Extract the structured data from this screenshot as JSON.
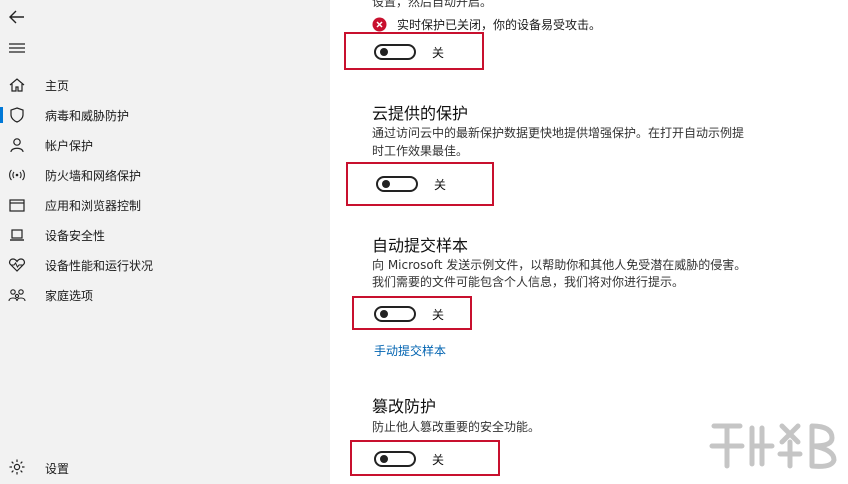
{
  "sidebar": {
    "items": [
      {
        "label": "主页",
        "icon": "home-icon"
      },
      {
        "label": "病毒和威胁防护",
        "icon": "shield-icon"
      },
      {
        "label": "帐户保护",
        "icon": "person-icon"
      },
      {
        "label": "防火墙和网络保护",
        "icon": "wifi-icon"
      },
      {
        "label": "应用和浏览器控制",
        "icon": "window-icon"
      },
      {
        "label": "设备安全性",
        "icon": "laptop-icon"
      },
      {
        "label": "设备性能和运行状况",
        "icon": "heart-icon"
      },
      {
        "label": "家庭选项",
        "icon": "family-icon"
      }
    ],
    "settings_label": "设置"
  },
  "main": {
    "top_cut_text": "设置，然后自动开启。",
    "warning_text": "实时保护已关闭，你的设备易受攻击。",
    "realtime_toggle_label": "关",
    "cloud": {
      "title": "云提供的保护",
      "desc1": "通过访问云中的最新保护数据更快地提供增强保护。在打开自动示例提",
      "desc2": "时工作效果最佳。",
      "toggle_label": "关"
    },
    "sample": {
      "title": "自动提交样本",
      "desc1": "向 Microsoft 发送示例文件，以帮助你和其他人免受潜在威胁的侵害。",
      "desc2": "我们需要的文件可能包含个人信息，我们将对你进行提示。",
      "toggle_label": "关",
      "link": "手动提交样本"
    },
    "tamper": {
      "title": "篡改防护",
      "desc": "防止他人篡改重要的安全功能。",
      "toggle_label": "关"
    }
  },
  "toggles_state": {
    "realtime": 0,
    "cloud": 0,
    "sample": 0,
    "tamper": 0
  },
  "colors": {
    "accent": "#0078d7",
    "link": "#0063b1",
    "error": "#c8102e",
    "highlight_box": "#c8102e",
    "sidebar_bg": "#f2f2f2"
  }
}
